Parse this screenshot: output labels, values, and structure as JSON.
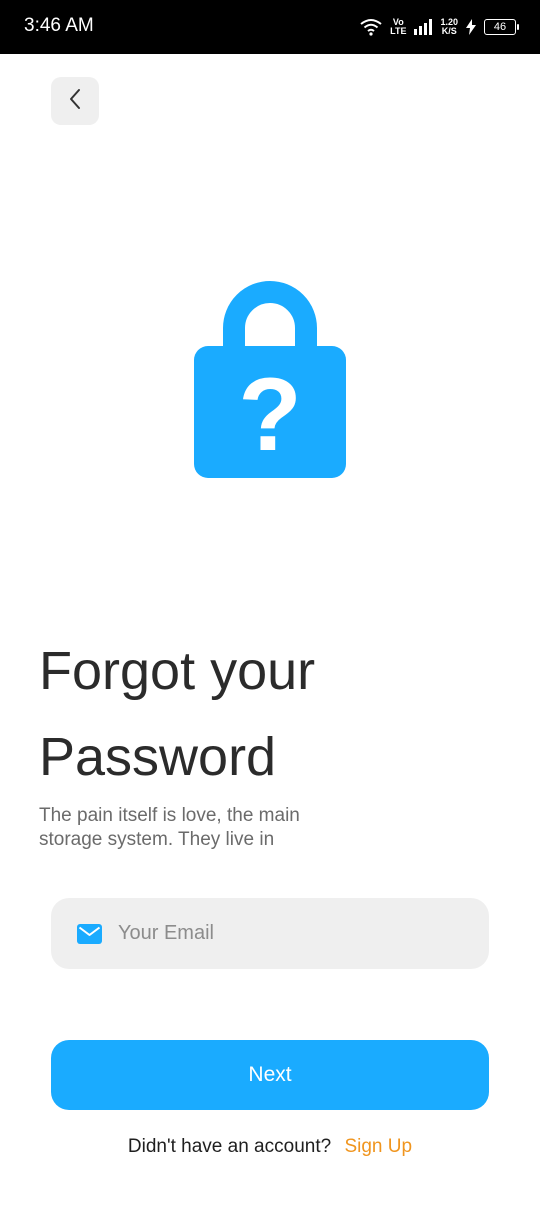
{
  "status_bar": {
    "time": "3:46 AM",
    "volte_top": "Vo",
    "volte_bottom": "LTE",
    "speed_value": "1.20",
    "speed_unit": "K/S",
    "battery": "46",
    "icons": [
      "wifi-icon",
      "volte-icon",
      "signal-icon",
      "speed-indicator",
      "charging-icon",
      "battery-icon"
    ]
  },
  "header": {
    "back_icon": "chevron-left-icon"
  },
  "illustration": {
    "icon": "lock-question-icon",
    "color": "#1aabff"
  },
  "main": {
    "title_line1": "Forgot your",
    "title_line2": "Password",
    "subtitle_line1": "The pain itself is love, the main",
    "subtitle_line2": "storage system. They live in"
  },
  "email_field": {
    "icon": "mail-icon",
    "placeholder": "Your Email",
    "value": ""
  },
  "actions": {
    "next_label": "Next"
  },
  "footer": {
    "prompt": "Didn't have an account?",
    "signup_label": "Sign Up"
  },
  "colors": {
    "accent": "#1aabff",
    "link": "#f0951e",
    "field_bg": "#efefef",
    "title_text": "#2b2b2b"
  }
}
